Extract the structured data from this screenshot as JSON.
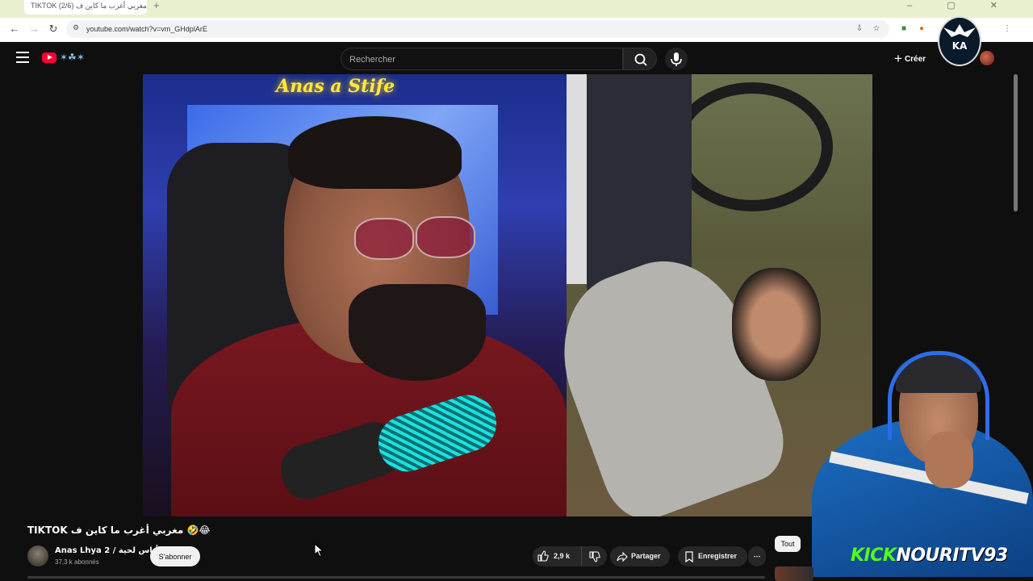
{
  "browser": {
    "tab_title": "TIKTOK مغربي أغرب ما كاين ف (2/6)",
    "new_tab": "+",
    "window_controls": "– ▢ ✕",
    "url": "youtube.com/watch?v=vm_GHdplArE"
  },
  "youtube": {
    "search_placeholder": "Rechercher",
    "create_label": "Créer"
  },
  "video": {
    "neon_sign": "Anas a Stife"
  },
  "overlay": {
    "kick_word": "KICK",
    "streamer_name": "NOURITV93"
  },
  "watch": {
    "title": "TIKTOK مغربي أغرب ما كاين ف 🤣😂",
    "channel_name": "Anas Lhya 2 / أناس لحية",
    "subscribers": "37,3 k abonnés",
    "subscribe_label": "S'abonner",
    "like_count": "2,9 k",
    "share_label": "Partager",
    "save_label": "Enregistrer",
    "more_label": "⋯",
    "chip_all": "Tout"
  },
  "colors": {
    "youtube_red": "#ff0033",
    "kick_green": "#53fc18",
    "background": "#0f0f0f"
  }
}
